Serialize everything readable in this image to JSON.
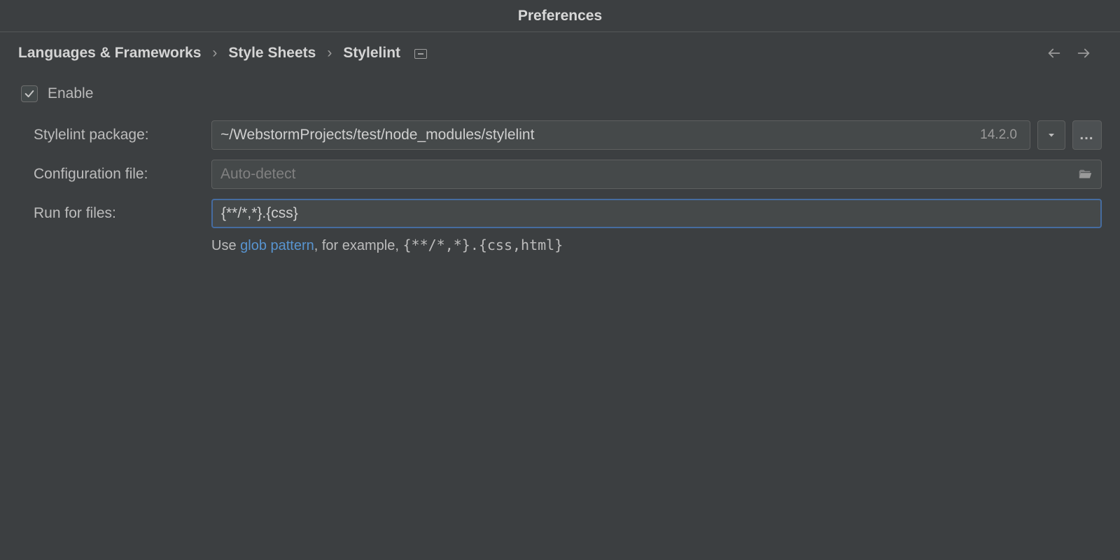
{
  "window": {
    "title": "Preferences"
  },
  "breadcrumb": {
    "items": [
      "Languages & Frameworks",
      "Style Sheets",
      "Stylelint"
    ]
  },
  "form": {
    "enable_label": "Enable",
    "enable_checked": true,
    "package": {
      "label": "Stylelint package:",
      "value": "~/WebstormProjects/test/node_modules/stylelint",
      "version": "14.2.0"
    },
    "config": {
      "label": "Configuration file:",
      "placeholder": "Auto-detect",
      "value": ""
    },
    "run_for": {
      "label": "Run for files:",
      "value": "{**/*,*}.{css}"
    },
    "hint": {
      "prefix": "Use ",
      "link_text": "glob pattern",
      "middle": ", for example, ",
      "example": "{**/*,*}.{css,html}"
    }
  }
}
